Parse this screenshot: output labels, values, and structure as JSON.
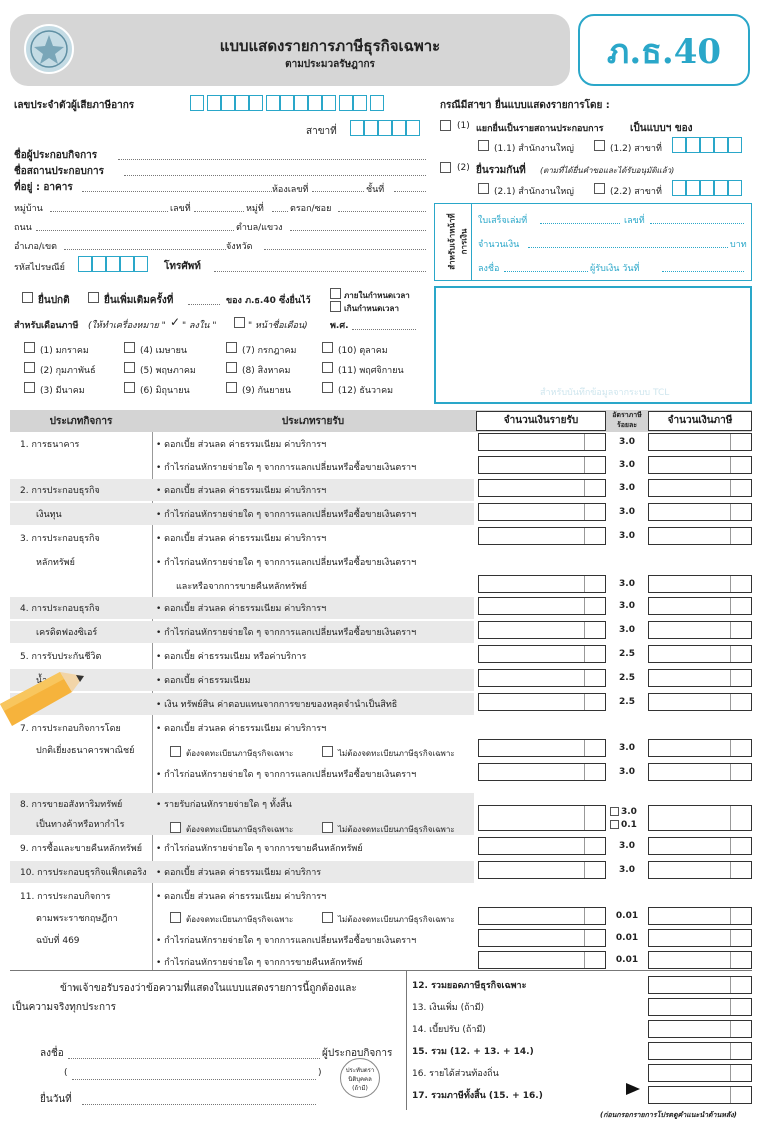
{
  "header": {
    "title": "แบบแสดงรายการภาษีธุรกิจเฉพาะ",
    "subtitle": "ตามประมวลรัษฎากร",
    "form_code": "ภ.ธ.40"
  },
  "taxpayer": {
    "tax_id_label": "เลขประจำตัวผู้เสียภาษีอากร",
    "branch_label": "สาขาที่",
    "operator_name_label": "ชื่อผู้ประกอบกิจการ",
    "establishment_label": "ชื่อสถานประกอบการ",
    "address_label": "ที่อยู่ : อาคาร",
    "room_label": "ห้องเลขที่",
    "floor_label": "ชั้นที่",
    "village_label": "หมู่บ้าน",
    "house_no_label": "เลขที่",
    "moo_label": "หมู่ที่",
    "lane_label": "ตรอก/ซอย",
    "road_label": "ถนน",
    "subdistrict_label": "ตำบล/แขวง",
    "district_label": "อำเภอ/เขต",
    "province_label": "จังหวัด",
    "postcode_label": "รหัสไปรษณีย์",
    "phone_label": "โทรศัพท์"
  },
  "branch_section": {
    "title": "กรณีมีสาขา ยื่นแบบแสดงรายการโดย :",
    "opt1_num": "(1)",
    "opt1_label": "แยกยื่นเป็นรายสถานประกอบการ",
    "opt1_bold": "เป็นแบบฯ ของ",
    "opt1_1": "(1.1) สำนักงานใหญ่",
    "opt1_2": "(1.2) สาขาที่",
    "opt2_num": "(2)",
    "opt2_label": "ยื่นรวมกันที่",
    "opt2_note": "(ตามที่ได้ยื่นคำขอและได้รับอนุมัติแล้ว)",
    "opt2_1": "(2.1) สำนักงานใหญ่",
    "opt2_2": "(2.2) สาขาที่"
  },
  "officer_box": {
    "side_label_1": "สำหรับเจ้าหน้าที่",
    "side_label_2": "การเงิน",
    "receipt_book": "ใบเสร็จเล่มที่",
    "receipt_no": "เลขที่",
    "amount": "จำนวนเงิน",
    "baht": "บาท",
    "signature": "ลงชื่อ",
    "receiver_date": "ผู้รับเงิน วันที่"
  },
  "filing": {
    "normal": "ยื่นปกติ",
    "additional": "ยื่นเพิ่มเติมครั้งที่",
    "of_form": "ของ ภ.ธ.40 ซึ่งยื่นไว้",
    "within": "ภายในกำหนดเวลา",
    "overdue": "เกินกำหนดเวลา",
    "month_label": "สำหรับเดือนภาษี",
    "month_note_1": "(ให้ทำเครื่องหมาย \"",
    "month_note_2": "\" ลงใน \"",
    "month_note_3": "\" หน้าชื่อเดือน)",
    "year_label": "พ.ศ.",
    "tcl_note": "สำหรับบันทึกข้อมูลจากระบบ TCL",
    "months": [
      "(1) มกราคม",
      "(4) เมษายน",
      "(7) กรกฎาคม",
      "(10) ตุลาคม",
      "(2) กุมภาพันธ์",
      "(5) พฤษภาคม",
      "(8) สิงหาคม",
      "(11) พฤศจิกายน",
      "(3) มีนาคม",
      "(6) มิถุนายน",
      "(9) กันยายน",
      "(12) ธันวาคม"
    ]
  },
  "table": {
    "col_business": "ประเภทกิจการ",
    "col_income": "ประเภทรายรับ",
    "col_amount": "จำนวนเงินรายรับ",
    "col_rate": "อัตราภาษีร้อยละ",
    "col_tax": "จำนวนเงินภาษี",
    "rows": [
      {
        "biz": "1.  การธนาคาร",
        "inc": "•  ดอกเบี้ย ส่วนลด ค่าธรรมเนียม ค่าบริการฯ",
        "rate": "3.0"
      },
      {
        "biz": "",
        "inc": "•  กำไรก่อนหักรายจ่ายใด ๆ จากการแลกเปลี่ยนหรือซื้อขายเงินตราฯ",
        "rate": "3.0"
      },
      {
        "biz": "2.  การประกอบธุรกิจ",
        "inc": "•  ดอกเบี้ย ส่วนลด ค่าธรรมเนียม ค่าบริการฯ",
        "rate": "3.0"
      },
      {
        "biz": "เงินทุน",
        "inc": "•  กำไรก่อนหักรายจ่ายใด ๆ จากการแลกเปลี่ยนหรือซื้อขายเงินตราฯ",
        "rate": "3.0"
      },
      {
        "biz": "3.  การประกอบธุรกิจ",
        "inc": "•  ดอกเบี้ย ส่วนลด ค่าธรรมเนียม ค่าบริการฯ",
        "rate": "3.0"
      },
      {
        "biz": "หลักทรัพย์",
        "inc": "•  กำไรก่อนหักรายจ่ายใด ๆ จากการแลกเปลี่ยนหรือซื้อขายเงินตราฯ",
        "rate": ""
      },
      {
        "biz": "",
        "inc": "และหรือจากการขายคืนหลักทรัพย์",
        "rate": "3.0"
      },
      {
        "biz": "4.  การประกอบธุรกิจ",
        "inc": "•  ดอกเบี้ย ส่วนลด ค่าธรรมเนียม ค่าบริการฯ",
        "rate": "3.0"
      },
      {
        "biz": "เครดิตฟองซิเอร์",
        "inc": "•  กำไรก่อนหักรายจ่ายใด ๆ จากการแลกเปลี่ยนหรือซื้อขายเงินตราฯ",
        "rate": "3.0"
      },
      {
        "biz": "5.  การรับประกันชีวิต",
        "inc": "•  ดอกเบี้ย ค่าธรรมเนียม หรือค่าบริการ",
        "rate": "2.5"
      },
      {
        "biz": "น้ำ",
        "inc": "•  ดอกเบี้ย ค่าธรรมเนียม",
        "rate": "2.5"
      },
      {
        "biz": "",
        "inc": "•  เงิน ทรัพย์สิน ค่าตอบแทนจากการขายของหลุดจำนำเป็นสิทธิ",
        "rate": "2.5"
      },
      {
        "biz": "7.  การประกอบกิจการโดย",
        "inc": "•  ดอกเบี้ย ส่วนลด ค่าธรรมเนียม ค่าบริการฯ",
        "rate": ""
      },
      {
        "biz": "ปกติเยี่ยงธนาคารพาณิชย์",
        "inc": "",
        "rate": "3.0"
      },
      {
        "biz": "",
        "inc": "•  กำไรก่อนหักรายจ่ายใด ๆ จากการแลกเปลี่ยนหรือซื้อขายเงินตราฯ",
        "rate": "3.0"
      },
      {
        "biz": "8.  การขายอสังหาริมทรัพย์",
        "inc": "•  รายรับก่อนหักรายจ่ายใด ๆ ทั้งสิ้น",
        "rate": ""
      },
      {
        "biz": "เป็นทางค้าหรือหากำไร",
        "inc": "",
        "rate": ""
      },
      {
        "biz": "9.  การซื้อและขายคืนหลักทรัพย์",
        "inc": "•  กำไรก่อนหักรายจ่ายใด ๆ จากการขายคืนหลักทรัพย์",
        "rate": "3.0"
      },
      {
        "biz": "10. การประกอบธุรกิจแฟ็กเตอริง",
        "inc": "•  ดอกเบี้ย ส่วนลด ค่าธรรมเนียม ค่าบริการ",
        "rate": "3.0"
      },
      {
        "biz": "11.  การประกอบกิจการ",
        "inc": "•  ดอกเบี้ย ส่วนลด ค่าธรรมเนียม ค่าบริการฯ",
        "rate": ""
      },
      {
        "biz": "ตามพระราชกฤษฎีกา",
        "inc": "",
        "rate": "0.01"
      },
      {
        "biz": "ฉบับที่ 469",
        "inc": "•  กำไรก่อนหักรายจ่ายใด ๆ จากการแลกเปลี่ยนหรือซื้อขายเงินตราฯ",
        "rate": "0.01"
      },
      {
        "biz": "",
        "inc": "•  กำไรก่อนหักรายจ่ายใด ๆ จากการขายคืนหลักทรัพย์",
        "rate": "0.01"
      }
    ],
    "must_register": "ต้องจดทะเบียนภาษีธุรกิจเฉพาะ",
    "not_register": "ไม่ต้องจดทะเบียนภาษีธุรกิจเฉพาะ",
    "rate_8a": "3.0",
    "rate_8b": "0.1"
  },
  "declaration": {
    "text_1": "ข้าพเจ้าขอรับรองว่าข้อความที่แสดงในแบบแสดงรายการนี้ถูกต้องและ",
    "text_2": "เป็นความจริงทุกประการ",
    "sign": "ลงชื่อ",
    "operator": "ผู้ประกอบกิจการ",
    "paren_open": "(",
    "paren_close": ")",
    "date": "ยื่นวันที่",
    "stamp_1": "ประทับตรา",
    "stamp_2": "นิติบุคคล",
    "stamp_3": "(ถ้ามี)"
  },
  "summary": {
    "items": [
      "12. รวมยอดภาษีธุรกิจเฉพาะ",
      "13. เงินเพิ่ม (ถ้ามี)",
      "14. เบี้ยปรับ (ถ้ามี)",
      "15. รวม (12. + 13. + 14.)",
      "16. รายได้ส่วนท้องถิ่น",
      "17. รวมภาษีทั้งสิ้น (15. + 16.)"
    ],
    "footnote": "(ก่อนกรอกรายการโปรดดูคำแนะนำด้านหลัง)"
  }
}
